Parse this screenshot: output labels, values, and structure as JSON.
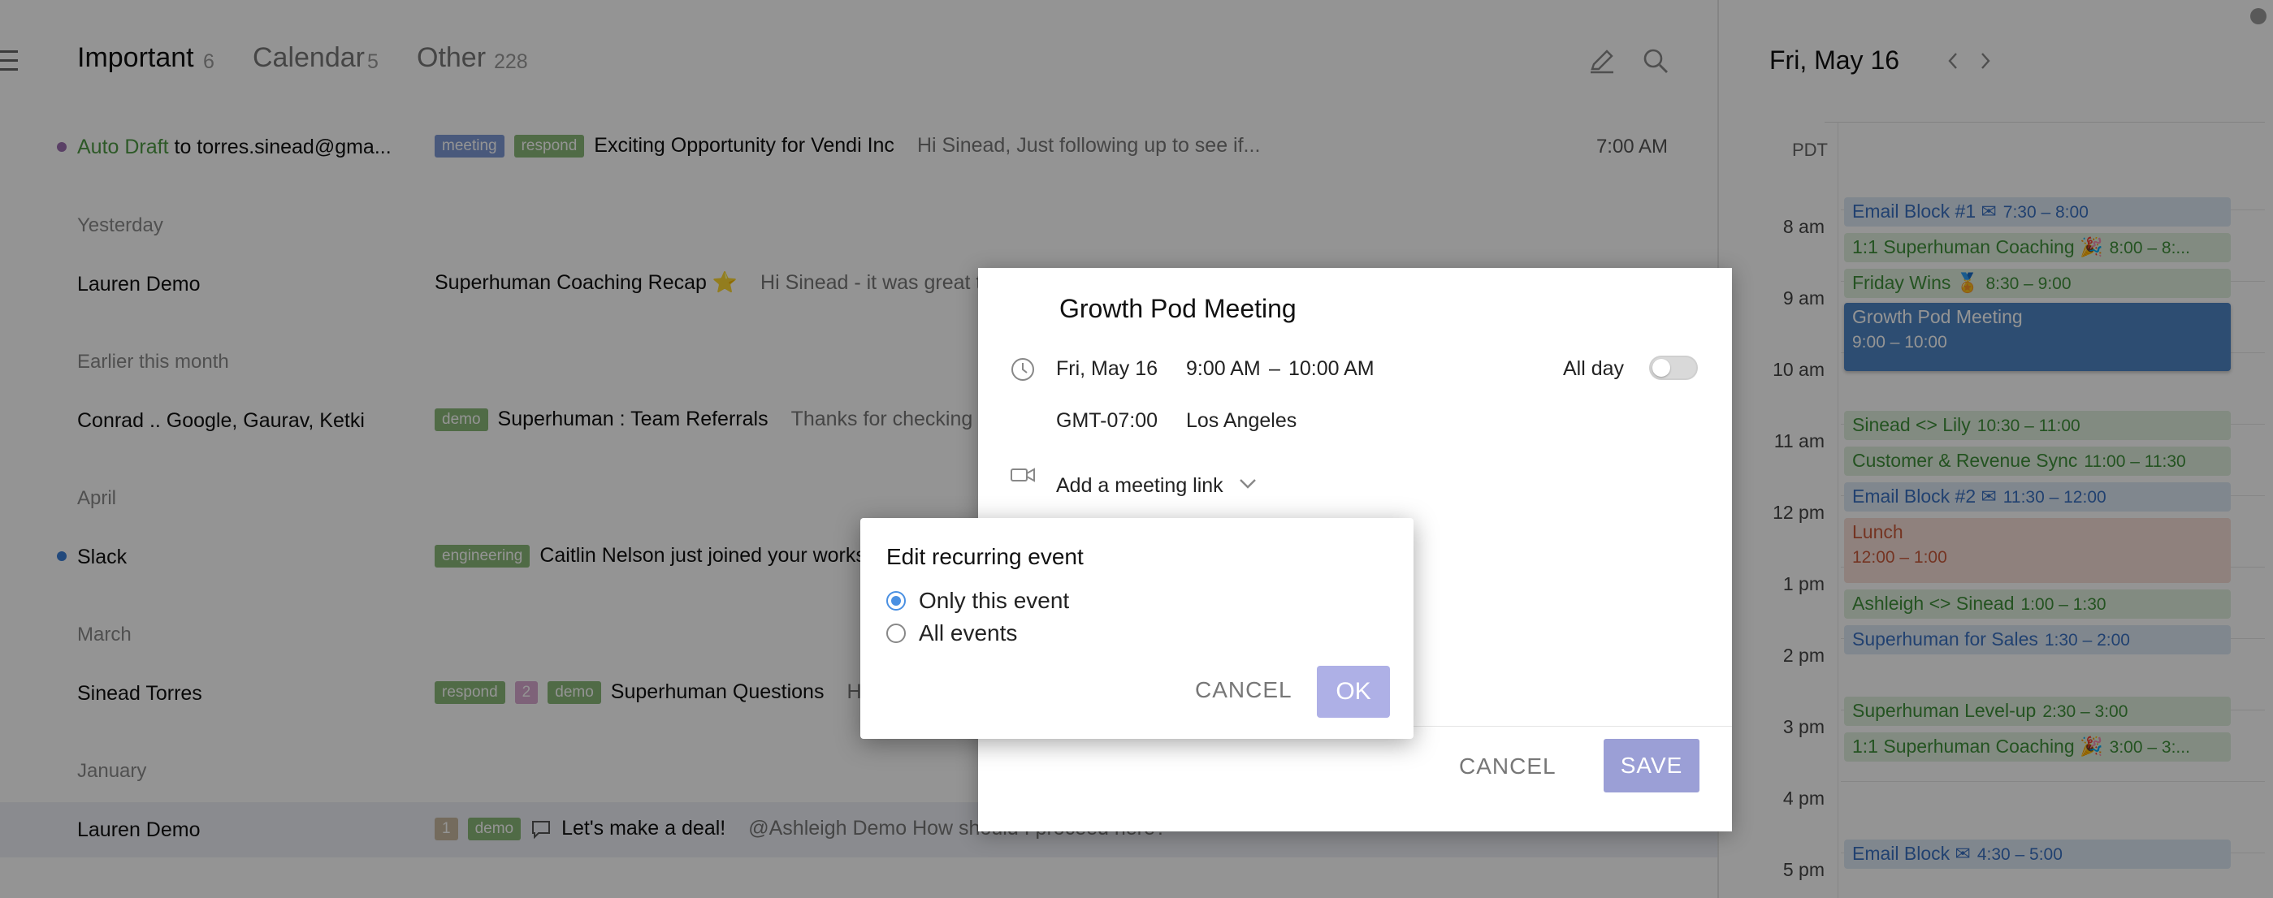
{
  "tabs": [
    {
      "label": "Important",
      "count": "6"
    },
    {
      "label": "Calendar",
      "count": "5"
    },
    {
      "label": "Other",
      "count": "228"
    }
  ],
  "icons": {
    "compose": "pencil-icon",
    "search": "search-icon",
    "menu": "hamburger-menu-icon"
  },
  "emails": {
    "row0": {
      "draft_label": "Auto Draft",
      "sender": " to torres.sinead@gma...",
      "tags": [
        "meeting",
        "respond"
      ],
      "subject": "Exciting Opportunity for Vendi Inc",
      "snippet": "Hi Sinead, Just following up to see if...",
      "time": "7:00 AM"
    },
    "section_yesterday": "Yesterday",
    "row1": {
      "sender": "Lauren Demo",
      "subject": "Superhuman Coaching Recap ⭐",
      "snippet": "Hi Sinead - it was great to m"
    },
    "section_earlier": "Earlier this month",
    "row2": {
      "sender": "Conrad .. Google, Gaurav, Ketki",
      "tags": [
        "demo"
      ],
      "subject": "Superhuman : Team Referrals",
      "snippet": "Thanks for checking in"
    },
    "section_april": "April",
    "row3": {
      "sender": "Slack",
      "tags": [
        "engineering"
      ],
      "subject": "Caitlin Nelson just joined your works"
    },
    "section_march": "March",
    "row4": {
      "sender": "Sinead Torres",
      "tags": [
        "respond",
        "2",
        "demo"
      ],
      "subject": "Superhuman Questions",
      "snippet": "H"
    },
    "section_january": "January",
    "row5": {
      "sender": "Lauren Demo",
      "tags": [
        "1",
        "demo"
      ],
      "subject": "Let's make a deal!",
      "snippet": "@Ashleigh Demo How should I proceed here?"
    }
  },
  "calendar": {
    "date": "Fri, May 16",
    "timezone": "PDT",
    "hours": [
      "8 am",
      "9 am",
      "10 am",
      "11 am",
      "12 pm",
      "1 pm",
      "2 pm",
      "3 pm",
      "4 pm",
      "5 pm"
    ],
    "events": [
      {
        "title": "Email Block #1 ✉",
        "time": "7:30 – 8:00"
      },
      {
        "title": "1:1 Superhuman Coaching 🎉",
        "time": "8:00 – 8:..."
      },
      {
        "title": "Friday Wins 🏅",
        "time": "8:30 – 9:00"
      },
      {
        "title": "Growth Pod Meeting",
        "time": "9:00 – 10:00"
      },
      {
        "title": "Sinead <> Lily",
        "time": "10:30 – 11:00"
      },
      {
        "title": "Customer & Revenue Sync",
        "time": "11:00 – 11:30"
      },
      {
        "title": "Email Block #2 ✉",
        "time": "11:30 – 12:00"
      },
      {
        "title": "Lunch",
        "time": "12:00 – 1:00"
      },
      {
        "title": "Ashleigh <> Sinead",
        "time": "1:00 – 1:30"
      },
      {
        "title": "Superhuman for Sales",
        "time": "1:30 – 2:00"
      },
      {
        "title": "Superhuman Level-up",
        "time": "2:30 – 3:00"
      },
      {
        "title": "1:1 Superhuman Coaching 🎉",
        "time": "3:00 – 3:..."
      },
      {
        "title": "Email Block ✉",
        "time": "4:30 – 5:00"
      }
    ]
  },
  "event_editor": {
    "title": "Growth Pod Meeting",
    "date": "Fri, May 16",
    "start": "9:00 AM",
    "dash": "–",
    "end": "10:00 AM",
    "all_day_label": "All day",
    "tz_offset": "GMT-07:00",
    "tz_city": "Los Angeles",
    "meeting_link_label": "Add a meeting link",
    "cancel_label": "CANCEL",
    "save_label": "SAVE"
  },
  "modal": {
    "title": "Edit recurring event",
    "option_this": "Only this event",
    "option_all": "All events",
    "selected": "Only this event",
    "cancel_label": "CANCEL",
    "ok_label": "OK",
    "accent": "#4a90e2"
  }
}
